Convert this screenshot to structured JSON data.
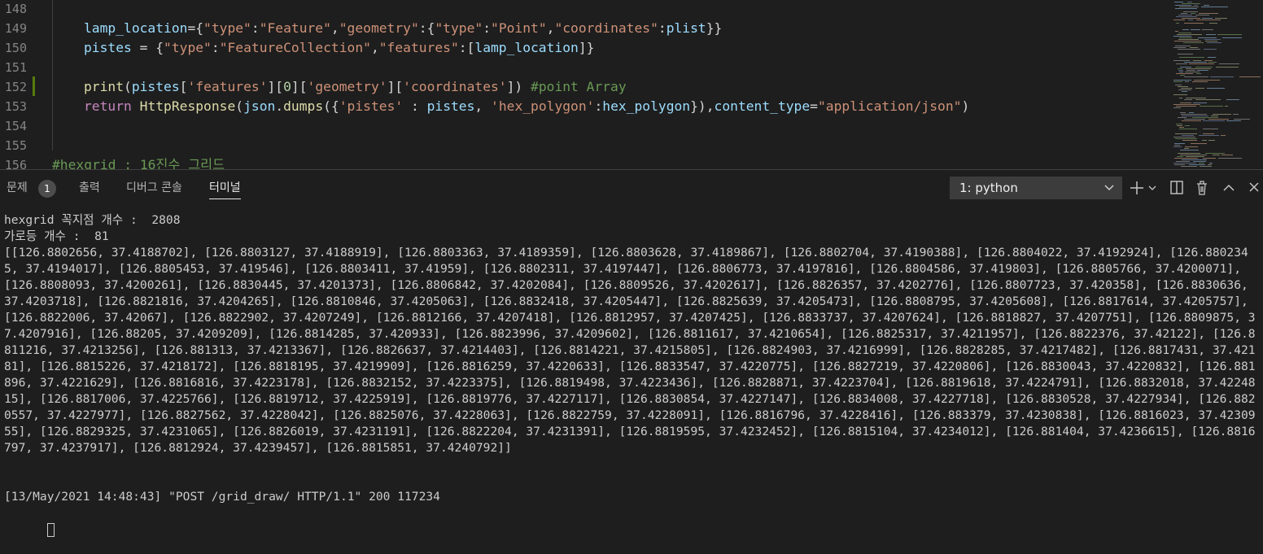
{
  "editor": {
    "lines": [
      {
        "num": "148",
        "tokens": []
      },
      {
        "num": "149",
        "tokens": [
          {
            "t": "lamp_location",
            "c": "v"
          },
          {
            "t": "={",
            "c": "p"
          },
          {
            "t": "\"type\"",
            "c": "s"
          },
          {
            "t": ":",
            "c": "p"
          },
          {
            "t": "\"Feature\"",
            "c": "s"
          },
          {
            "t": ",",
            "c": "p"
          },
          {
            "t": "\"geometry\"",
            "c": "s"
          },
          {
            "t": ":{",
            "c": "p"
          },
          {
            "t": "\"type\"",
            "c": "s"
          },
          {
            "t": ":",
            "c": "p"
          },
          {
            "t": "\"Point\"",
            "c": "s"
          },
          {
            "t": ",",
            "c": "p"
          },
          {
            "t": "\"coordinates\"",
            "c": "s"
          },
          {
            "t": ":",
            "c": "p"
          },
          {
            "t": "plist",
            "c": "v"
          },
          {
            "t": "}}",
            "c": "p"
          }
        ]
      },
      {
        "num": "150",
        "tokens": [
          {
            "t": "pistes",
            "c": "v"
          },
          {
            "t": " = {",
            "c": "p"
          },
          {
            "t": "\"type\"",
            "c": "s"
          },
          {
            "t": ":",
            "c": "p"
          },
          {
            "t": "\"FeatureCollection\"",
            "c": "s"
          },
          {
            "t": ",",
            "c": "p"
          },
          {
            "t": "\"features\"",
            "c": "s"
          },
          {
            "t": ":[",
            "c": "p"
          },
          {
            "t": "lamp_location",
            "c": "v"
          },
          {
            "t": "]}",
            "c": "p"
          }
        ]
      },
      {
        "num": "151",
        "tokens": []
      },
      {
        "num": "152",
        "tokens": [
          {
            "t": "print",
            "c": "f"
          },
          {
            "t": "(",
            "c": "p"
          },
          {
            "t": "pistes",
            "c": "v"
          },
          {
            "t": "[",
            "c": "p"
          },
          {
            "t": "'features'",
            "c": "s"
          },
          {
            "t": "][",
            "c": "p"
          },
          {
            "t": "0",
            "c": "n"
          },
          {
            "t": "][",
            "c": "p"
          },
          {
            "t": "'geometry'",
            "c": "s"
          },
          {
            "t": "][",
            "c": "p"
          },
          {
            "t": "'coordinates'",
            "c": "s"
          },
          {
            "t": "]) ",
            "c": "p"
          },
          {
            "t": "#point Array",
            "c": "c"
          }
        ]
      },
      {
        "num": "153",
        "tokens": [
          {
            "t": "return",
            "c": "k"
          },
          {
            "t": " ",
            "c": "p"
          },
          {
            "t": "HttpResponse",
            "c": "f"
          },
          {
            "t": "(",
            "c": "p"
          },
          {
            "t": "json",
            "c": "v"
          },
          {
            "t": ".",
            "c": "p"
          },
          {
            "t": "dumps",
            "c": "f"
          },
          {
            "t": "({",
            "c": "p"
          },
          {
            "t": "'pistes'",
            "c": "s"
          },
          {
            "t": " : ",
            "c": "p"
          },
          {
            "t": "pistes",
            "c": "v"
          },
          {
            "t": ", ",
            "c": "p"
          },
          {
            "t": "'hex_polygon'",
            "c": "s"
          },
          {
            "t": ":",
            "c": "p"
          },
          {
            "t": "hex_polygon",
            "c": "v"
          },
          {
            "t": "}),",
            "c": "p"
          },
          {
            "t": "content_type",
            "c": "v"
          },
          {
            "t": "=",
            "c": "p"
          },
          {
            "t": "\"application/json\"",
            "c": "s"
          },
          {
            "t": ")",
            "c": "p"
          }
        ]
      },
      {
        "num": "154",
        "tokens": []
      },
      {
        "num": "155",
        "tokens": []
      },
      {
        "num": "156",
        "tokens": [
          {
            "t": "#hexgrid : 16진수 그리드",
            "c": "c"
          }
        ],
        "outdent": true
      }
    ]
  },
  "panel": {
    "tabs": [
      {
        "label": "문제",
        "name": "tab-problems"
      },
      {
        "label": "출력",
        "name": "tab-output"
      },
      {
        "label": "디버그 콘솔",
        "name": "tab-debug-console"
      },
      {
        "label": "터미널",
        "name": "tab-terminal",
        "active": true
      }
    ],
    "problems_badge": "1",
    "terminal_select": "1: python",
    "icons": {
      "add": "plus-icon",
      "split": "split-terminal-icon",
      "kill": "trash-icon",
      "maximize": "chevron-up-icon",
      "close": "close-icon"
    }
  },
  "terminal": {
    "vertex_line": "hexgrid 꼭지점 개수 :  2808",
    "lamp_line": "가로등 개수 :  81",
    "array_output": "[[126.8802656, 37.4188702], [126.8803127, 37.4188919], [126.8803363, 37.4189359], [126.8803628, 37.4189867], [126.8802704, 37.4190388], [126.8804022, 37.4192924], [126.8802345, 37.4194017], [126.8805453, 37.419546], [126.8803411, 37.41959], [126.8802311, 37.4197447], [126.8806773, 37.4197816], [126.8804586, 37.419803], [126.8805766, 37.4200071], [126.8808093, 37.4200261], [126.8830445, 37.4201373], [126.8806842, 37.4202084], [126.8809526, 37.4202617], [126.8826357, 37.4202776], [126.8807723, 37.420358], [126.8830636, 37.4203718], [126.8821816, 37.4204265], [126.8810846, 37.4205063], [126.8832418, 37.4205447], [126.8825639, 37.4205473], [126.8808795, 37.4205608], [126.8817614, 37.4205757], [126.8822006, 37.42067], [126.8822902, 37.4207249], [126.8812166, 37.4207418], [126.8812957, 37.4207425], [126.8833737, 37.4207624], [126.8818827, 37.4207751], [126.8809875, 37.4207916], [126.88205, 37.4209209], [126.8814285, 37.420933], [126.8823996, 37.4209602], [126.8811617, 37.4210654], [126.8825317, 37.4211957], [126.8822376, 37.42122], [126.8811216, 37.4213256], [126.881313, 37.4213367], [126.8826637, 37.4214403], [126.8814221, 37.4215805], [126.8824903, 37.4216999], [126.8828285, 37.4217482], [126.8817431, 37.42181], [126.8815226, 37.4218172], [126.8818195, 37.4219909], [126.8816259, 37.4220633], [126.8833547, 37.4220775], [126.8827219, 37.4220806], [126.8830043, 37.4220832], [126.881896, 37.4221629], [126.8816816, 37.4223178], [126.8832152, 37.4223375], [126.8819498, 37.4223436], [126.8828871, 37.4223704], [126.8819618, 37.4224791], [126.8832018, 37.4224815], [126.8817006, 37.4225766], [126.8819712, 37.4225919], [126.8819776, 37.4227117], [126.8830854, 37.4227147], [126.8834008, 37.4227718], [126.8830528, 37.4227934], [126.8820557, 37.4227977], [126.8827562, 37.4228042], [126.8825076, 37.4228063], [126.8822759, 37.4228091], [126.8816796, 37.4228416], [126.883379, 37.4230838], [126.8816023, 37.4230955], [126.8829325, 37.4231065], [126.8826019, 37.4231191], [126.8822204, 37.4231391], [126.8819595, 37.4232452], [126.8815104, 37.4234012], [126.881404, 37.4236615], [126.8816797, 37.4237917], [126.8812924, 37.4239457], [126.8815851, 37.4240792]]",
    "log_line": "[13/May/2021 14:48:43] \"POST /grid_draw/ HTTP/1.1\" 200 117234"
  },
  "colors": {
    "background": "#1e1e1e",
    "string": "#ce9178",
    "variable": "#9cdcfe",
    "function": "#dcdcaa",
    "keyword": "#c586c0",
    "comment": "#6a9955",
    "number": "#b5cea8"
  }
}
